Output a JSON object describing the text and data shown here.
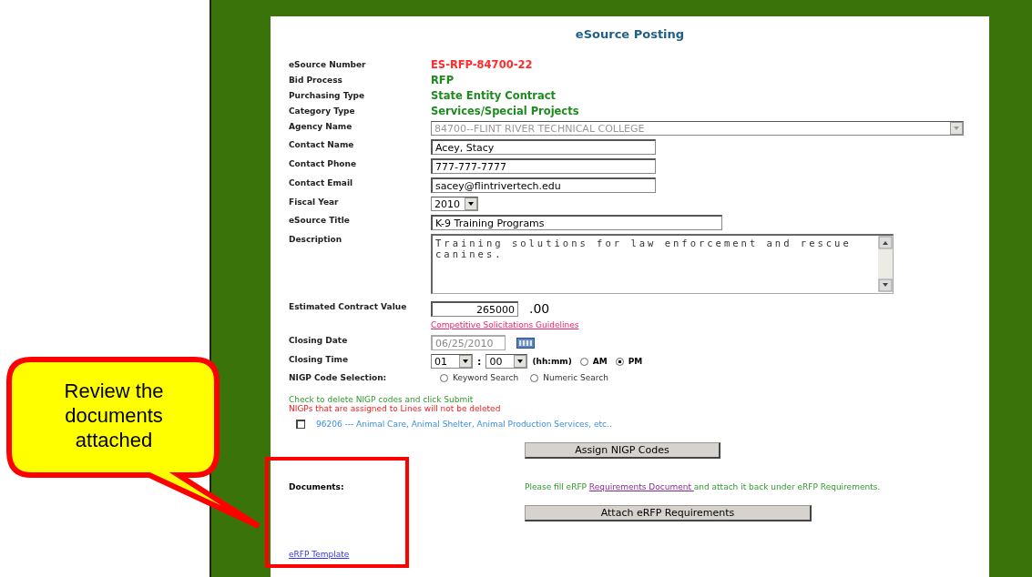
{
  "title": "eSource Posting",
  "fields": [
    {
      "label": "eSource Number",
      "kind": "static",
      "value": "ES-RFP-84700-22",
      "color": "#ff2a2a"
    },
    {
      "label": "Bid Process",
      "kind": "static",
      "value": "RFP",
      "color": "#1f8a1f"
    },
    {
      "label": "Purchasing Type",
      "kind": "static",
      "value": "State Entity Contract",
      "color": "#1f8a1f"
    },
    {
      "label": "Category Type",
      "kind": "static",
      "value": "Services/Special Projects",
      "color": "#1f8a1f"
    },
    {
      "label": "Agency Name",
      "kind": "select",
      "value": "84700--FLINT RIVER TECHNICAL COLLEGE",
      "disabled": true,
      "wide": true
    },
    {
      "label": "Contact Name",
      "kind": "input",
      "value": "Acey, Stacy"
    },
    {
      "label": "Contact Phone",
      "kind": "input",
      "value": "777-777-7777"
    },
    {
      "label": "Contact Email",
      "kind": "input",
      "value": "sacey@flintrivertech.edu"
    },
    {
      "label": "Fiscal Year",
      "kind": "select",
      "value": "2010",
      "disabled": false,
      "wide": false
    },
    {
      "label": "eSource Title",
      "kind": "input",
      "value": "K-9 Training Programs",
      "wide": true
    },
    {
      "label": "Description",
      "kind": "textarea",
      "value": "Training solutions for law enforcement and rescue canines."
    },
    {
      "label": "Estimated Contract Value",
      "kind": "amount",
      "value": "265000",
      "suffix": ".00",
      "link": "Competitive Solicitations Guidelines"
    },
    {
      "label": "Closing Date",
      "kind": "date",
      "value": "06/25/2010",
      "disabled": true
    },
    {
      "label": "Closing Time",
      "kind": "time",
      "hour": "01",
      "separator": ":",
      "minute": "00",
      "format": "(hh:mm)",
      "options": [
        {
          "label": "AM",
          "selected": false
        },
        {
          "label": "PM",
          "selected": true
        }
      ]
    },
    {
      "label": "NIGP Code Selection:",
      "kind": "radios",
      "options": [
        {
          "label": "Keyword Search",
          "selected": false
        },
        {
          "label": "Numeric Search",
          "selected": false
        }
      ]
    }
  ],
  "nigp": {
    "instruction": "Check to delete NIGP codes and click Submit",
    "warning": "NIGPs that are assigned to Lines will not be deleted",
    "codes": [
      {
        "text": "96206 --- Animal Care, Animal Shelter, Animal Production Services, etc..",
        "checked": false
      }
    ],
    "button": "Assign NIGP Codes"
  },
  "documents": {
    "label": "Documents:",
    "note_before": "Please fill eRFP ",
    "note_link": "Requirements Document ",
    "note_after": "and attach it back under eRFP Requirements.",
    "button": "Attach eRFP Requirements",
    "template_link": "eRFP Template"
  },
  "callout": {
    "text": "Review the documents attached"
  }
}
